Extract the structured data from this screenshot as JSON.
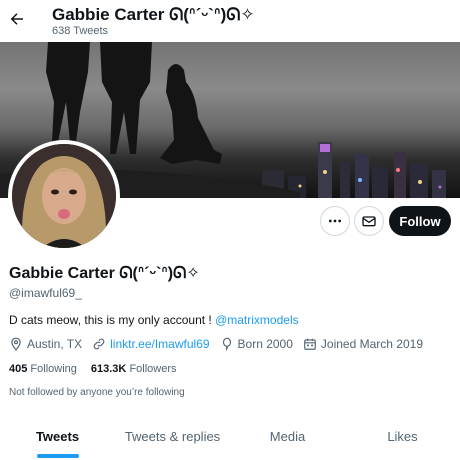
{
  "header": {
    "name": "Gabbie Carter ᘏ(ᐢ´ᵕ`ᐢ)ᘏ✧",
    "tweet_count": "638 Tweets"
  },
  "profile": {
    "display_name": "Gabbie Carter ᘏ(ᐢ´ᵕ`ᐢ)ᘏ✧",
    "handle": "@imawful69_",
    "bio_text": "D cats meow, this is my only account ! ",
    "bio_mention": "@matrixmodels",
    "location": "Austin, TX",
    "website": "linktr.ee/Imawful69",
    "born": "Born 2000",
    "joined": "Joined March 2019",
    "following_count": "405",
    "following_label": "Following",
    "followers_count": "613.3K",
    "followers_label": "Followers",
    "followed_note": "Not followed by anyone you’re following"
  },
  "actions": {
    "follow_label": "Follow"
  },
  "tabs": [
    {
      "label": "Tweets",
      "active": true
    },
    {
      "label": "Tweets & replies",
      "active": false
    },
    {
      "label": "Media",
      "active": false
    },
    {
      "label": "Likes",
      "active": false
    }
  ],
  "icons": {
    "back": "arrow-left-icon",
    "more": "more-horizontal-icon",
    "message": "envelope-icon",
    "location": "location-pin-icon",
    "link": "link-icon",
    "birthday": "balloon-icon",
    "calendar": "calendar-icon"
  },
  "colors": {
    "accent": "#1d9bf0",
    "text": "#0f1419",
    "secondary": "#536471",
    "follow_bg": "#0f1419"
  }
}
